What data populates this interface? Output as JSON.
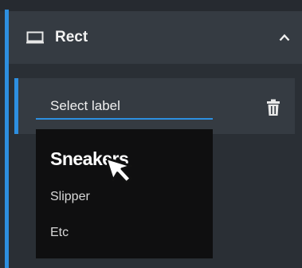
{
  "panel": {
    "title": "Rect",
    "icon": "rectangle-icon",
    "collapse_icon": "chevron-up-icon",
    "accent_color": "#2d8fe0"
  },
  "label_row": {
    "select_placeholder": "Select label",
    "delete_icon": "trash-icon"
  },
  "dropdown": {
    "options": [
      "Sneakers",
      "Slipper",
      "Etc"
    ],
    "selected": "Sneakers",
    "background": "#0f0f10"
  },
  "pointer": "mouse-cursor-icon"
}
